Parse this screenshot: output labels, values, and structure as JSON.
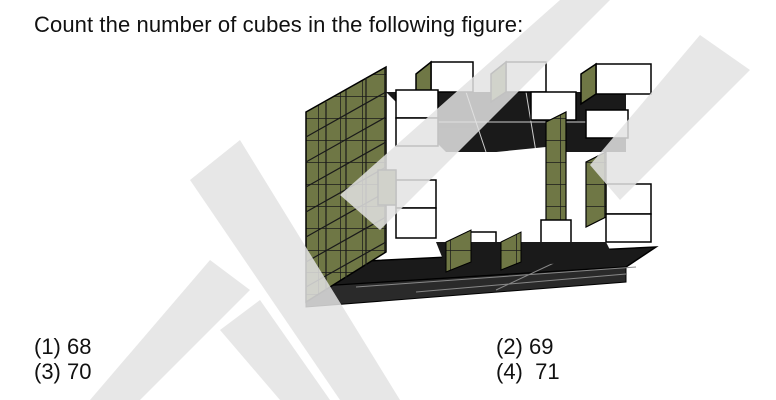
{
  "question": {
    "text": "Count the number of cubes in the following figure:"
  },
  "figure": {
    "description_icon": "cube-structure-figure"
  },
  "options": [
    {
      "label": "(1) 68"
    },
    {
      "label": "(2) 69"
    },
    {
      "label": "(3) 70"
    },
    {
      "label": "(4)  71"
    }
  ],
  "colors": {
    "text": "#111111",
    "watermark": "#e3e3e3",
    "shade": "#6f7745",
    "dark": "#1a1a1a"
  }
}
